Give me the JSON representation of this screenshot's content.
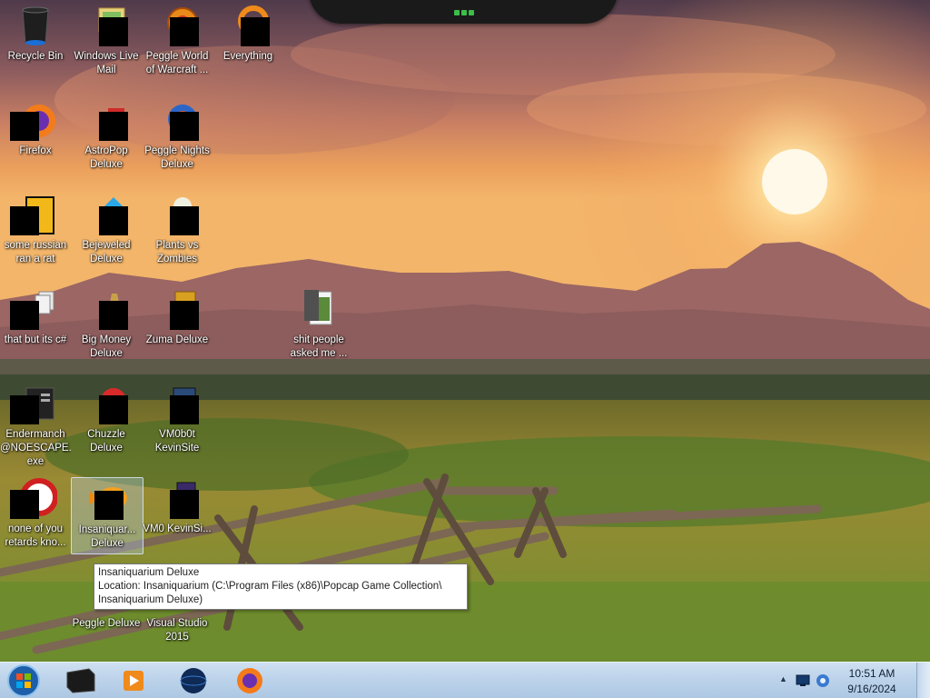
{
  "wallpaper": {
    "sky_top": "#5d3f48",
    "sky_glow": "#f0a35a",
    "sun": "#fff5d6",
    "mountains": "#8b5a5a",
    "field": "#8d8a2f",
    "grass": "#6f8a2a"
  },
  "desktop_icons": [
    {
      "label": "Recycle Bin",
      "icon": "recycle-bin-icon"
    },
    {
      "label": "Windows Live Mail",
      "icon": "mail-icon"
    },
    {
      "label": "Peggle World of Warcraft ...",
      "icon": "peggle-wow-icon"
    },
    {
      "label": "Everything",
      "icon": "everything-search-icon"
    },
    {
      "label": "Firefox",
      "icon": "firefox-icon"
    },
    {
      "label": "AstroPop Deluxe",
      "icon": "astropop-icon"
    },
    {
      "label": "Peggle Nights Deluxe",
      "icon": "peggle-nights-icon"
    },
    {
      "label": "some russian ran a rat",
      "icon": "script-file-icon"
    },
    {
      "label": "Bejeweled Deluxe",
      "icon": "bejeweled-icon"
    },
    {
      "label": "Plants vs Zombies",
      "icon": "plants-vs-zombies-icon"
    },
    {
      "label": "that but its c#",
      "icon": "stacked-files-icon"
    },
    {
      "label": "Big Money Deluxe",
      "icon": "big-money-icon"
    },
    {
      "label": "Zuma Deluxe",
      "icon": "zuma-icon"
    },
    {
      "label": "shit people asked me ...",
      "icon": "folder-icon"
    },
    {
      "label": "Endermanch @NOESCAPE. exe",
      "icon": "executable-icon"
    },
    {
      "label": "Chuzzle Deluxe",
      "icon": "chuzzle-icon"
    },
    {
      "label": "VM0b0t KevinSite",
      "icon": "vm-shortcut-icon"
    },
    {
      "label": "none of you retards kno...",
      "icon": "red-circle-icon"
    },
    {
      "label": "Insaniquarium Deluxe",
      "icon": "insaniquarium-fish-icon"
    },
    {
      "label": "VM0 KevinSi...",
      "icon": "vm-shortcut-icon"
    },
    {
      "label": "Peggle Deluxe",
      "icon": "peggle-icon"
    },
    {
      "label": "Visual Studio 2015",
      "icon": "visual-studio-icon"
    }
  ],
  "tooltip": {
    "line1": "Insaniquarium Deluxe",
    "line2": "Location: Insaniquarium (C:\\Program Files (x86)\\Popcap Game Collection\\",
    "line3": "Insaniquarium Deluxe)"
  },
  "insaniquarium_label_short": "Insaniquar... Deluxe",
  "taskbar": {
    "pinned": [
      {
        "name": "Command Prompt",
        "icon": "terminal-icon"
      },
      {
        "name": "Windows Media Player",
        "icon": "media-player-icon"
      },
      {
        "name": "Network/Globe",
        "icon": "globe-icon"
      },
      {
        "name": "Firefox",
        "icon": "firefox-icon"
      }
    ],
    "tray": {
      "show_hidden": "▲",
      "time": "10:51 AM",
      "date": "9/16/2024"
    }
  },
  "colors": {
    "taskbar": "#bcd3ea",
    "tooltip_border": "#767676",
    "gadget_led": "#3bbf4a"
  }
}
